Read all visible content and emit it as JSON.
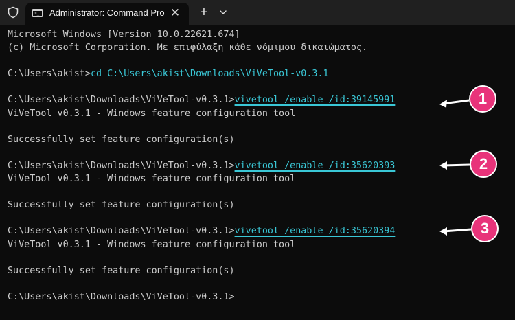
{
  "window": {
    "tab_title": "Administrator: Command Pro",
    "close_glyph": "✕",
    "new_tab_glyph": "+"
  },
  "terminal": {
    "lines": [
      {
        "text": "Microsoft Windows [Version 10.0.22621.674]"
      },
      {
        "text": "(c) Microsoft Corporation. Με επιφύλαξη κάθε νόμιμου δικαιώματος."
      },
      {
        "text": ""
      },
      {
        "prompt": "C:\\Users\\akist>",
        "command": "cd C:\\Users\\akist\\Downloads\\ViVeTool-v0.3.1"
      },
      {
        "text": ""
      },
      {
        "prompt": "C:\\Users\\akist\\Downloads\\ViVeTool-v0.3.1>",
        "command": "vivetool /enable /id:39145991"
      },
      {
        "text": "ViVeTool v0.3.1 - Windows feature configuration tool"
      },
      {
        "text": ""
      },
      {
        "text": "Successfully set feature configuration(s)"
      },
      {
        "text": ""
      },
      {
        "prompt": "C:\\Users\\akist\\Downloads\\ViVeTool-v0.3.1>",
        "command": "vivetool /enable /id:35620393"
      },
      {
        "text": "ViVeTool v0.3.1 - Windows feature configuration tool"
      },
      {
        "text": ""
      },
      {
        "text": "Successfully set feature configuration(s)"
      },
      {
        "text": ""
      },
      {
        "prompt": "C:\\Users\\akist\\Downloads\\ViVeTool-v0.3.1>",
        "command": "vivetool /enable /id:35620394"
      },
      {
        "text": "ViVeTool v0.3.1 - Windows feature configuration tool"
      },
      {
        "text": ""
      },
      {
        "text": "Successfully set feature configuration(s)"
      },
      {
        "text": ""
      },
      {
        "prompt": "C:\\Users\\akist\\Downloads\\ViVeTool-v0.3.1>",
        "command": ""
      }
    ]
  },
  "annotations": {
    "badge_1": "1",
    "badge_2": "2",
    "badge_3": "3"
  },
  "colors": {
    "background": "#0c0c0c",
    "titlebar": "#202020",
    "text": "#cccccc",
    "command": "#3ac7d6",
    "callout": "#e8337a"
  }
}
